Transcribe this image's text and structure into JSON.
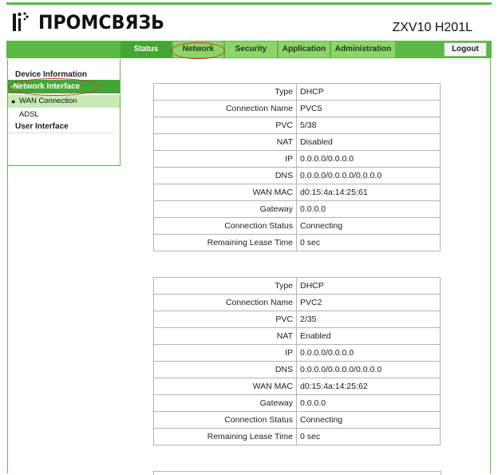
{
  "header": {
    "brand": "ПРОМСВЯЗЬ",
    "model": "ZXV10 H201L"
  },
  "nav": {
    "tabs": [
      "Status",
      "Network",
      "Security",
      "Application",
      "Administration"
    ],
    "active": "Status",
    "logout": "Logout"
  },
  "sidebar": {
    "device_information": "Device Information",
    "network_interface": "-Network Interface",
    "wan_connection": "WAN Connection",
    "adsl": "ADSL",
    "user_interface": "User Interface"
  },
  "connections": [
    {
      "rows": [
        {
          "label": "Type",
          "value": "DHCP"
        },
        {
          "label": "Connection Name",
          "value": "PVC5"
        },
        {
          "label": "PVC",
          "value": "5/38"
        },
        {
          "label": "NAT",
          "value": "Disabled"
        },
        {
          "label": "IP",
          "value": "0.0.0.0/0.0.0.0"
        },
        {
          "label": "DNS",
          "value": "0.0.0.0/0.0.0.0/0.0.0.0"
        },
        {
          "label": "WAN MAC",
          "value": "d0:15:4a:14:25:61"
        },
        {
          "label": "Gateway",
          "value": "0.0.0.0"
        },
        {
          "label": "Connection Status",
          "value": "Connecting"
        },
        {
          "label": "Remaining Lease Time",
          "value": "0 sec"
        }
      ]
    },
    {
      "rows": [
        {
          "label": "Type",
          "value": "DHCP"
        },
        {
          "label": "Connection Name",
          "value": "PVC2"
        },
        {
          "label": "PVC",
          "value": "2/35"
        },
        {
          "label": "NAT",
          "value": "Enabled"
        },
        {
          "label": "IP",
          "value": "0.0.0.0/0.0.0.0"
        },
        {
          "label": "DNS",
          "value": "0.0.0.0/0.0.0.0/0.0.0.0"
        },
        {
          "label": "WAN MAC",
          "value": "d0:15:4a:14:25:62"
        },
        {
          "label": "Gateway",
          "value": "0.0.0.0"
        },
        {
          "label": "Connection Status",
          "value": "Connecting"
        },
        {
          "label": "Remaining Lease Time",
          "value": "0 sec"
        }
      ]
    }
  ],
  "colors": {
    "accent": "#5bb847",
    "tab_active": "#44a534",
    "tab_inactive": "#8fd36b",
    "highlight_ellipse": "#c0392b"
  }
}
